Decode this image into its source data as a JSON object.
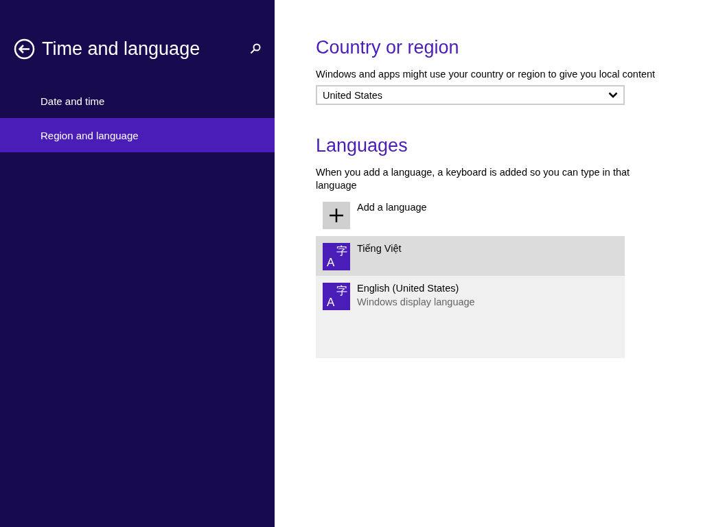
{
  "sidebar": {
    "title": "Time and language",
    "items": [
      {
        "label": "Date and time",
        "selected": false
      },
      {
        "label": "Region and language",
        "selected": true
      }
    ]
  },
  "country": {
    "heading": "Country or region",
    "description": "Windows and apps might use your country or region to give you local content",
    "dropdown": {
      "value": "United States"
    }
  },
  "languages": {
    "heading": "Languages",
    "description": "When you add a language, a keyboard is added so you can type in that language",
    "add_button": {
      "label": "Add a language"
    },
    "items": [
      {
        "name": "Tiếng Việt",
        "icon_letter": "A",
        "icon_char": "字",
        "selected": true
      },
      {
        "name": "English (United States)",
        "subtitle": "Windows display language",
        "icon_letter": "A",
        "icon_char": "字",
        "selected": false
      }
    ]
  }
}
